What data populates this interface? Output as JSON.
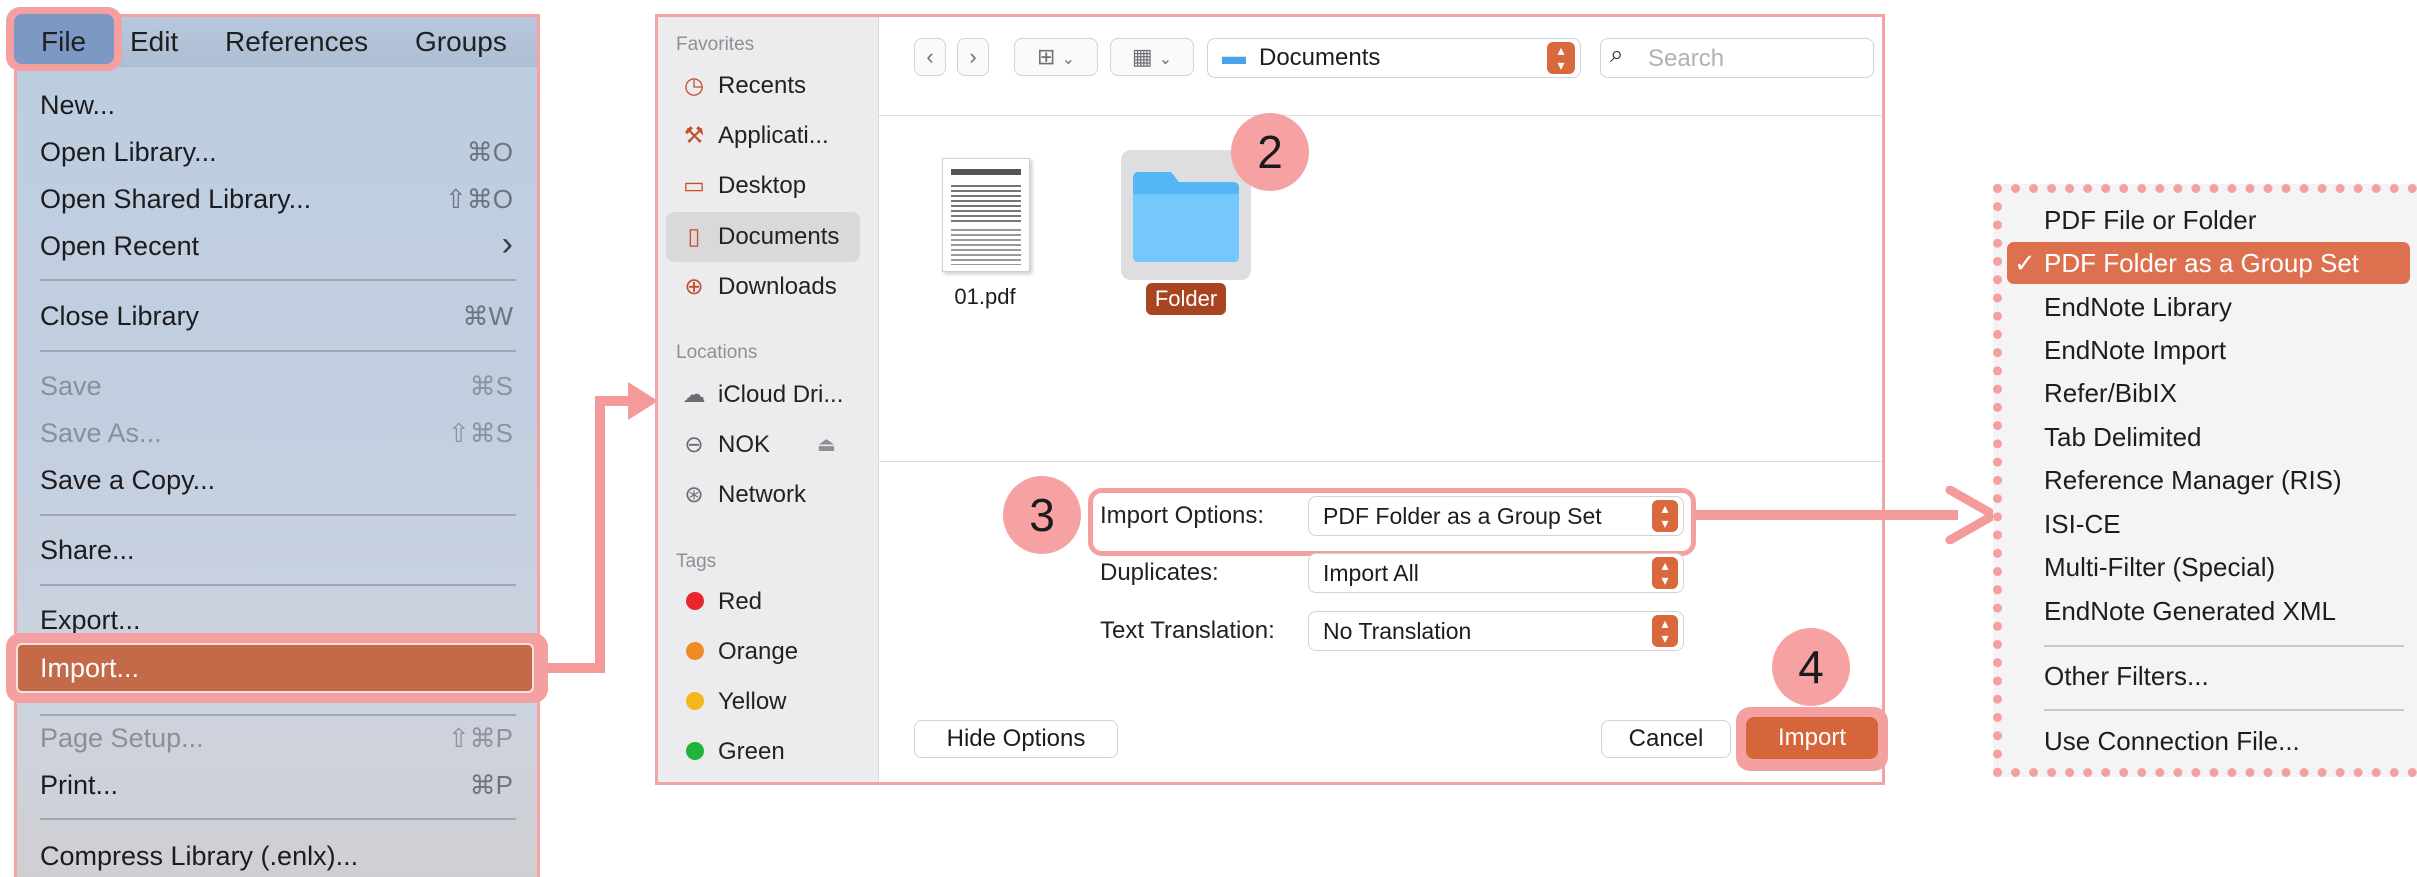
{
  "menu": {
    "menubar": [
      "File",
      "Edit",
      "References",
      "Groups"
    ],
    "items": [
      {
        "label": "New...",
        "shortcut": ""
      },
      {
        "label": "Open Library...",
        "shortcut": "⌘O"
      },
      {
        "label": "Open Shared Library...",
        "shortcut": "⇧⌘O"
      },
      {
        "label": "Open Recent",
        "shortcut": "›"
      },
      {
        "label": "Close Library",
        "shortcut": "⌘W"
      },
      {
        "label": "Save",
        "shortcut": "⌘S"
      },
      {
        "label": "Save As...",
        "shortcut": "⇧⌘S"
      },
      {
        "label": "Save a Copy...",
        "shortcut": ""
      },
      {
        "label": "Share...",
        "shortcut": ""
      },
      {
        "label": "Export...",
        "shortcut": ""
      },
      {
        "label": "Import...",
        "shortcut": ""
      },
      {
        "label": "Page Setup...",
        "shortcut": "⇧⌘P"
      },
      {
        "label": "Print...",
        "shortcut": "⌘P"
      },
      {
        "label": "Compress Library (.enlx)...",
        "shortcut": ""
      }
    ]
  },
  "dialog": {
    "sidebar": {
      "favorites_heading": "Favorites",
      "favorites": [
        "Recents",
        "Applicati...",
        "Desktop",
        "Documents",
        "Downloads"
      ],
      "locations_heading": "Locations",
      "locations": [
        "iCloud Dri...",
        "NOK",
        "Network"
      ],
      "tags_heading": "Tags",
      "tags": [
        {
          "label": "Red",
          "color": "#e8262b"
        },
        {
          "label": "Orange",
          "color": "#f08a24"
        },
        {
          "label": "Yellow",
          "color": "#f2b81c"
        },
        {
          "label": "Green",
          "color": "#22b33a"
        }
      ]
    },
    "toolbar": {
      "location": "Documents",
      "search_placeholder": "Search"
    },
    "files": [
      {
        "name": "01.pdf",
        "kind": "pdf"
      },
      {
        "name": "Folder",
        "kind": "folder"
      }
    ],
    "options": {
      "import_options_label": "Import Options:",
      "import_options_value": "PDF Folder as a Group Set",
      "duplicates_label": "Duplicates:",
      "duplicates_value": "Import All",
      "translation_label": "Text Translation:",
      "translation_value": "No Translation"
    },
    "buttons": {
      "hide_options": "Hide Options",
      "cancel": "Cancel",
      "import": "Import"
    }
  },
  "steps": [
    "2",
    "3",
    "4"
  ],
  "formats": {
    "items": [
      "PDF File or Folder",
      "PDF Folder as a Group Set",
      "EndNote Library",
      "EndNote Import",
      "Refer/BibIX",
      "Tab Delimited",
      "Reference Manager (RIS)",
      "ISI-CE",
      "Multi-Filter (Special)",
      "EndNote Generated XML",
      "Other Filters...",
      "Use Connection File..."
    ],
    "checkmark": "✓"
  },
  "colors": {
    "highlight": "#f5a0a0",
    "accent": "#d9693c",
    "selected_menu": "#c46a48"
  }
}
